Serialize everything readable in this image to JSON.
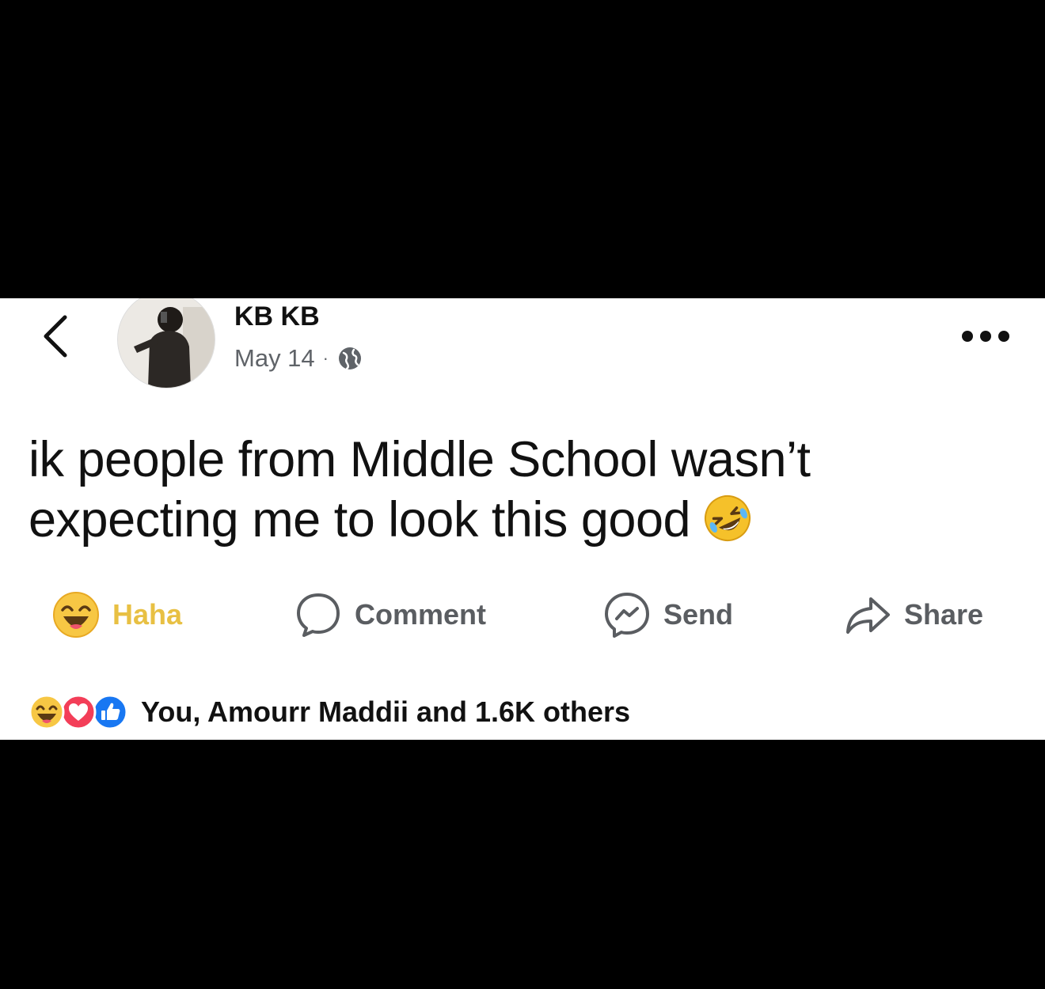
{
  "post": {
    "author_name": "KB KB",
    "date": "May 14",
    "separator": "·",
    "text": "ik people from Middle School wasn’t expecting me to look this good",
    "inline_emoji": "rolling-on-floor-laughing-emoji"
  },
  "actions": {
    "haha_label": "Haha",
    "comment_label": "Comment",
    "send_label": "Send",
    "share_label": "Share"
  },
  "reactions": {
    "summary": "You, Amourr Maddii and 1.6K others",
    "icons": [
      "haha-reaction-icon",
      "love-reaction-icon",
      "like-reaction-icon"
    ]
  },
  "colors": {
    "haha_yellow": "#e8c043",
    "text_dark": "#111111",
    "text_gray": "#5a5d61",
    "like_blue": "#1877f2",
    "love_red": "#f33e58"
  }
}
